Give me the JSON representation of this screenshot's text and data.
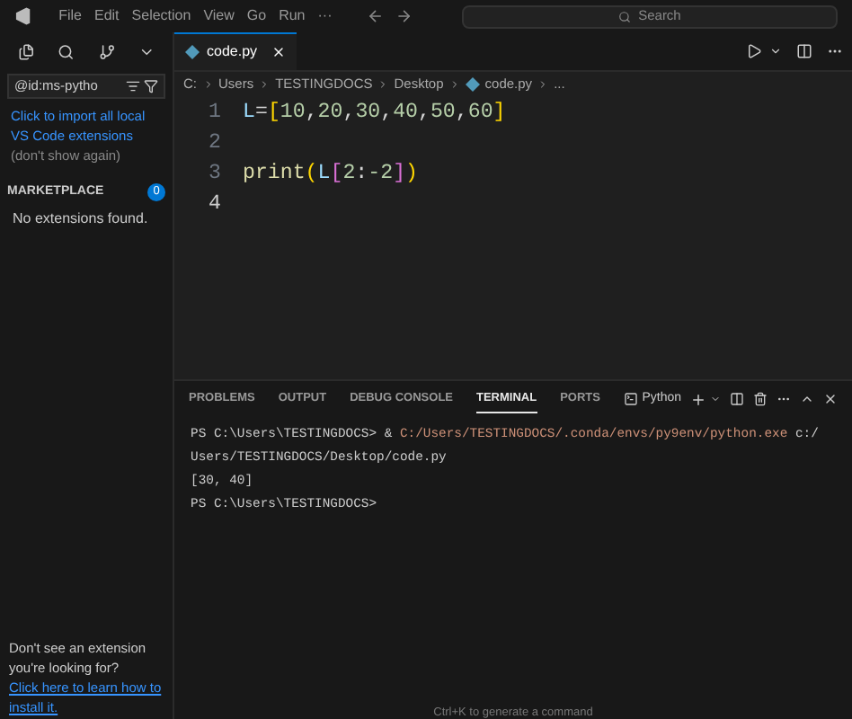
{
  "menu": [
    "File",
    "Edit",
    "Selection",
    "View",
    "Go",
    "Run",
    "···"
  ],
  "search": {
    "placeholder": "Search"
  },
  "sidebar": {
    "filter": {
      "value": "@id:ms-pytho"
    },
    "notice": {
      "link": "Click to import all local VS Code extensions",
      "text": "(don't show again)"
    },
    "section": {
      "title": "MARKETPLACE",
      "count": "0",
      "empty": "No extensions found."
    },
    "footer": {
      "text": "Don't see an extension you're looking for?",
      "link": "Click here to learn how to install it."
    }
  },
  "editor": {
    "tabs": [
      {
        "label": "code.py",
        "selected": true
      }
    ],
    "breadcrumb": [
      "C:",
      "Users",
      "TESTINGDOCS",
      "Desktop",
      "code.py",
      "..."
    ],
    "lines": [
      {
        "number": "1",
        "current": false,
        "tokens": [
          {
            "kind": "var",
            "text": "L"
          },
          {
            "kind": "op",
            "text": "="
          },
          {
            "kind": "bracket",
            "text": "["
          },
          {
            "kind": "num",
            "text": "10"
          },
          {
            "kind": "op",
            "text": ","
          },
          {
            "kind": "num",
            "text": "20"
          },
          {
            "kind": "op",
            "text": ","
          },
          {
            "kind": "num",
            "text": "30"
          },
          {
            "kind": "op",
            "text": ","
          },
          {
            "kind": "num",
            "text": "40"
          },
          {
            "kind": "op",
            "text": ","
          },
          {
            "kind": "num",
            "text": "50"
          },
          {
            "kind": "op",
            "text": ","
          },
          {
            "kind": "num",
            "text": "60"
          },
          {
            "kind": "bracket",
            "text": "]"
          }
        ]
      },
      {
        "number": "2",
        "current": false
      },
      {
        "number": "3",
        "current": false,
        "tokens": [
          {
            "kind": "func",
            "text": "print"
          },
          {
            "kind": "bracket",
            "text": "("
          },
          {
            "kind": "var",
            "text": "L"
          },
          {
            "kind": "bracket2",
            "text": "["
          },
          {
            "kind": "num",
            "text": "2"
          },
          {
            "kind": "op",
            "text": ":"
          },
          {
            "kind": "num",
            "text": "-2"
          },
          {
            "kind": "bracket2",
            "text": "]"
          },
          {
            "kind": "bracket",
            "text": ")"
          }
        ]
      },
      {
        "number": "4",
        "current": true
      }
    ]
  },
  "panel": {
    "tabs": [
      {
        "label": "PROBLEMS",
        "selected": false
      },
      {
        "label": "OUTPUT",
        "selected": false
      },
      {
        "label": "DEBUG CONSOLE",
        "selected": false
      },
      {
        "label": "TERMINAL",
        "selected": true
      },
      {
        "label": "PORTS",
        "selected": false
      }
    ],
    "shell": "Python",
    "terminal": [
      [
        {
          "kind": "plain",
          "text": "PS C:\\Users\\TESTINGDOCS> & "
        },
        {
          "kind": "path",
          "text": "C:/Users/TESTINGDOCS/.conda/envs/py9env/python.exe"
        },
        {
          "kind": "plain",
          "text": " c:/"
        }
      ],
      [
        {
          "kind": "plain",
          "text": "Users/TESTINGDOCS/Desktop/code.py"
        }
      ],
      [
        {
          "kind": "plain",
          "text": "[30, 40]"
        }
      ],
      [
        {
          "kind": "plain",
          "text": "PS C:\\Users\\TESTINGDOCS>"
        }
      ]
    ],
    "hint": "Ctrl+K to generate a command"
  }
}
